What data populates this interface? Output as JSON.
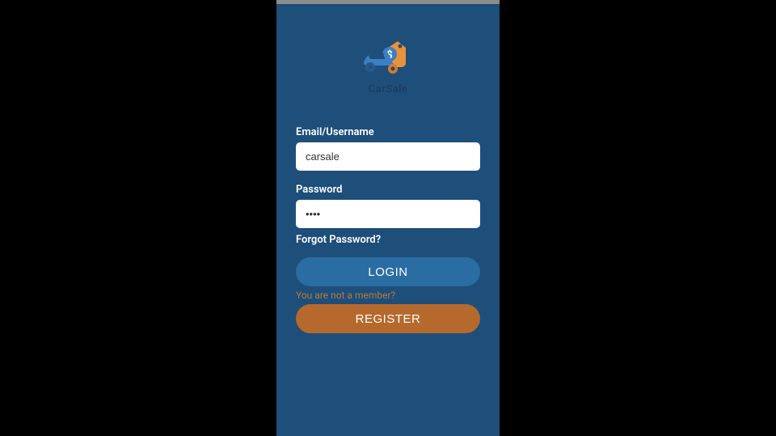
{
  "brand": {
    "name": "CarSale"
  },
  "form": {
    "email_label": "Email/Username",
    "email_value": "carsale",
    "password_label": "Password",
    "password_value": "••••",
    "forgot_label": "Forgot Password?"
  },
  "actions": {
    "login_label": "LOGIN",
    "register_label": "REGISTER",
    "not_member_label": "You are not a member?"
  }
}
